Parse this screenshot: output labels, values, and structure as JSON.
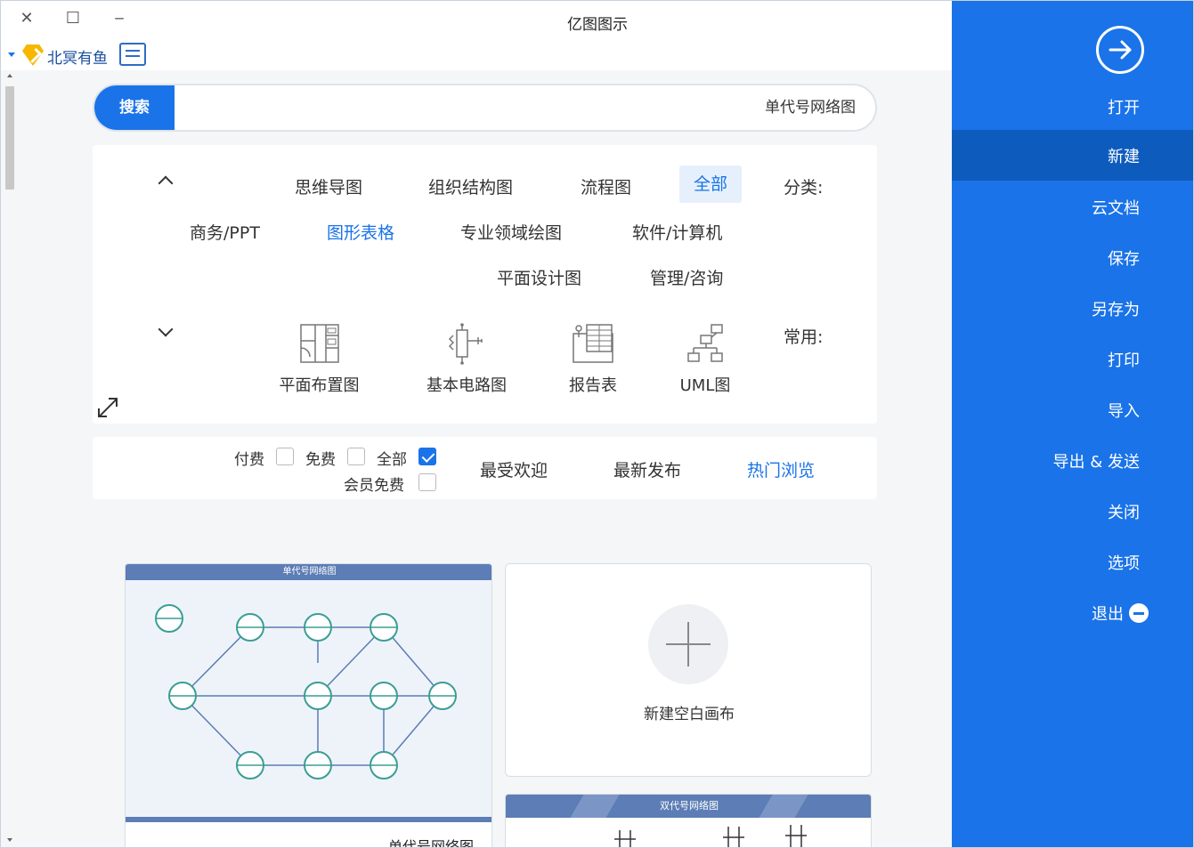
{
  "window": {
    "title": "亿图图示",
    "controls": [
      "close-icon",
      "maximize-icon",
      "minimize-icon"
    ]
  },
  "account": {
    "name": "北冥有鱼",
    "badge_icon": "vip-diamond-icon",
    "message_icon": "message-icon"
  },
  "sidebar": {
    "back_icon": "arrow-right-circle-icon",
    "items": [
      {
        "label": "打开",
        "active": false
      },
      {
        "label": "新建",
        "active": true
      },
      {
        "label": "云文档",
        "active": false
      },
      {
        "label": "保存",
        "active": false
      },
      {
        "label": "另存为",
        "active": false
      },
      {
        "label": "打印",
        "active": false
      },
      {
        "label": "导入",
        "active": false
      },
      {
        "label": "导出 & 发送",
        "active": false
      },
      {
        "label": "关闭",
        "active": false
      },
      {
        "label": "选项",
        "active": false
      },
      {
        "label": "退出",
        "active": false
      }
    ],
    "accent": "#1a73e8",
    "active_bg": "#0e5bbe"
  },
  "search": {
    "button": "搜索",
    "value": "单代号网络图"
  },
  "categories": {
    "label": "分类:",
    "items": [
      {
        "label": "全部",
        "state": "selected"
      },
      {
        "label": "流程图",
        "state": "normal"
      },
      {
        "label": "组织结构图",
        "state": "normal"
      },
      {
        "label": "思维导图",
        "state": "normal"
      },
      {
        "label": "软件/计算机",
        "state": "normal"
      },
      {
        "label": "专业领域绘图",
        "state": "normal"
      },
      {
        "label": "图形表格",
        "state": "active"
      },
      {
        "label": "商务/PPT",
        "state": "normal"
      },
      {
        "label": "管理/咨询",
        "state": "normal"
      },
      {
        "label": "平面设计图",
        "state": "normal"
      }
    ]
  },
  "common": {
    "label": "常用:",
    "items": [
      {
        "label": "UML图",
        "icon": "uml-diagram-icon"
      },
      {
        "label": "报告表",
        "icon": "report-table-icon"
      },
      {
        "label": "基本电路图",
        "icon": "circuit-icon"
      },
      {
        "label": "平面布置图",
        "icon": "floor-plan-icon"
      }
    ]
  },
  "sort": {
    "tabs": [
      {
        "label": "热门浏览",
        "active": true
      },
      {
        "label": "最新发布",
        "active": false
      },
      {
        "label": "最受欢迎",
        "active": false
      }
    ],
    "filters": [
      {
        "label": "全部",
        "checked": true
      },
      {
        "label": "免费",
        "checked": false
      },
      {
        "label": "付费",
        "checked": false
      },
      {
        "label": "会员免费",
        "checked": false
      }
    ]
  },
  "templates": {
    "card1": {
      "header": "单代号网络图",
      "name": "单代号网络图"
    },
    "blank": {
      "label": "新建空白画布"
    },
    "card2": {
      "header": "双代号网络图"
    }
  }
}
